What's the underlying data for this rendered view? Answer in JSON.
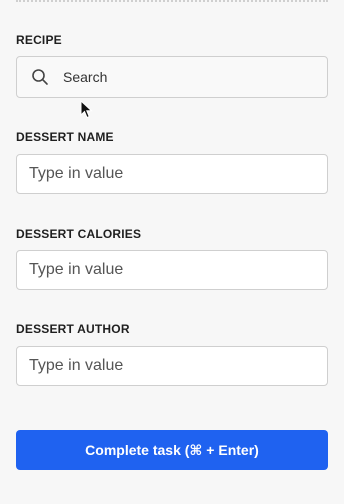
{
  "recipe": {
    "label": "RECIPE",
    "search_placeholder": "Search"
  },
  "fields": [
    {
      "label": "DESSERT NAME",
      "placeholder": "Type in value"
    },
    {
      "label": "DESSERT CALORIES",
      "placeholder": "Type in value"
    },
    {
      "label": "DESSERT AUTHOR",
      "placeholder": "Type in value"
    }
  ],
  "submit": {
    "label": "Complete task (⌘ + Enter)",
    "color": "#1f62f0"
  },
  "icons": {
    "search": "search-icon",
    "cursor": "mouse-pointer-icon"
  }
}
